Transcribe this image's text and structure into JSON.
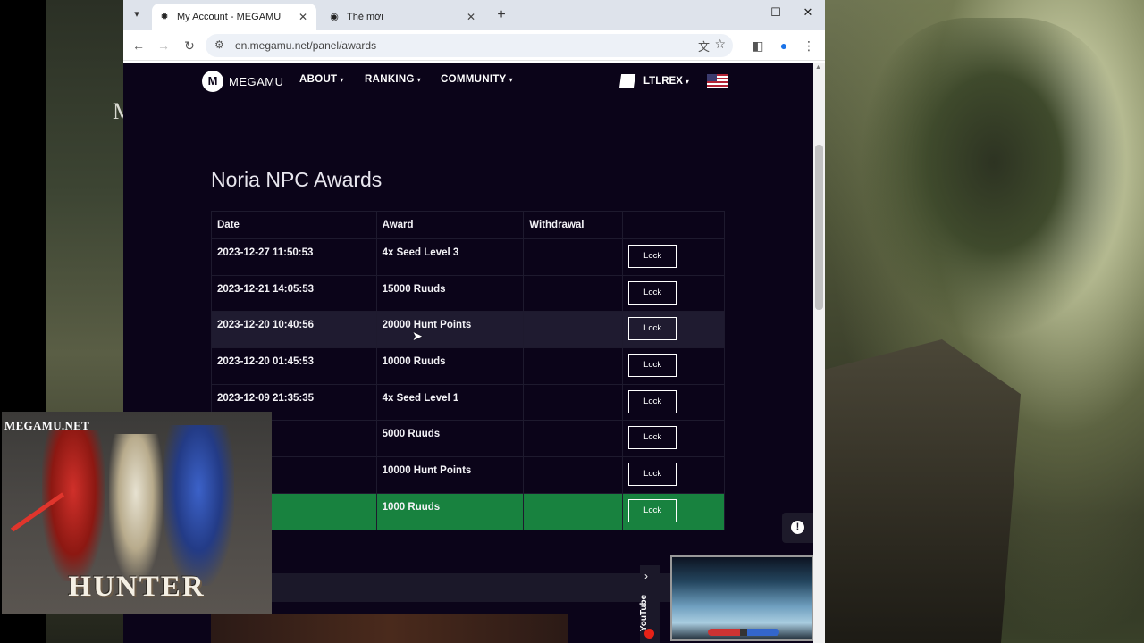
{
  "left_art": {
    "mark": "M"
  },
  "browser": {
    "tabs": [
      {
        "title": "My Account - MEGAMU",
        "active": true
      },
      {
        "title": "Thẻ mới",
        "active": false
      }
    ],
    "url": "en.megamu.net/panel/awards"
  },
  "site": {
    "logo_text": "MEGAMU",
    "nav": [
      {
        "label": "ABOUT"
      },
      {
        "label": "RANKING"
      },
      {
        "label": "COMMUNITY"
      }
    ],
    "user": "LTLREX"
  },
  "awards": {
    "title": "Noria NPC Awards",
    "columns": [
      "Date",
      "Award",
      "Withdrawal",
      ""
    ],
    "rows": [
      {
        "date": "2023-12-27 11:50:53",
        "award": "4x Seed Level 3",
        "withdrawal": "",
        "action": "Lock"
      },
      {
        "date": "2023-12-21 14:05:53",
        "award": "15000 Ruuds",
        "withdrawal": "",
        "action": "Lock"
      },
      {
        "date": "2023-12-20 10:40:56",
        "award": "20000 Hunt Points",
        "withdrawal": "",
        "action": "Lock"
      },
      {
        "date": "2023-12-20 01:45:53",
        "award": "10000 Ruuds",
        "withdrawal": "",
        "action": "Lock"
      },
      {
        "date": "2023-12-09 21:35:35",
        "award": "4x Seed Level 1",
        "withdrawal": "",
        "action": "Lock"
      },
      {
        "date": "9 21:25:35",
        "award": "5000 Ruuds",
        "withdrawal": "",
        "action": "Lock"
      },
      {
        "date": "9 21:20:35",
        "award": "10000 Hunt Points",
        "withdrawal": "",
        "action": "Lock"
      },
      {
        "date": "9 21:15:36",
        "award": "1000 Ruuds",
        "withdrawal": "",
        "action": "Lock"
      }
    ]
  },
  "youtube": {
    "label": "YouTube"
  },
  "overlay": {
    "brand": "MEGAMU.NET",
    "title": "HUNTER"
  },
  "colors": {
    "page_bg": "#0b0419",
    "selected_row": "#18823f",
    "hover_row": "#1f1b30"
  }
}
